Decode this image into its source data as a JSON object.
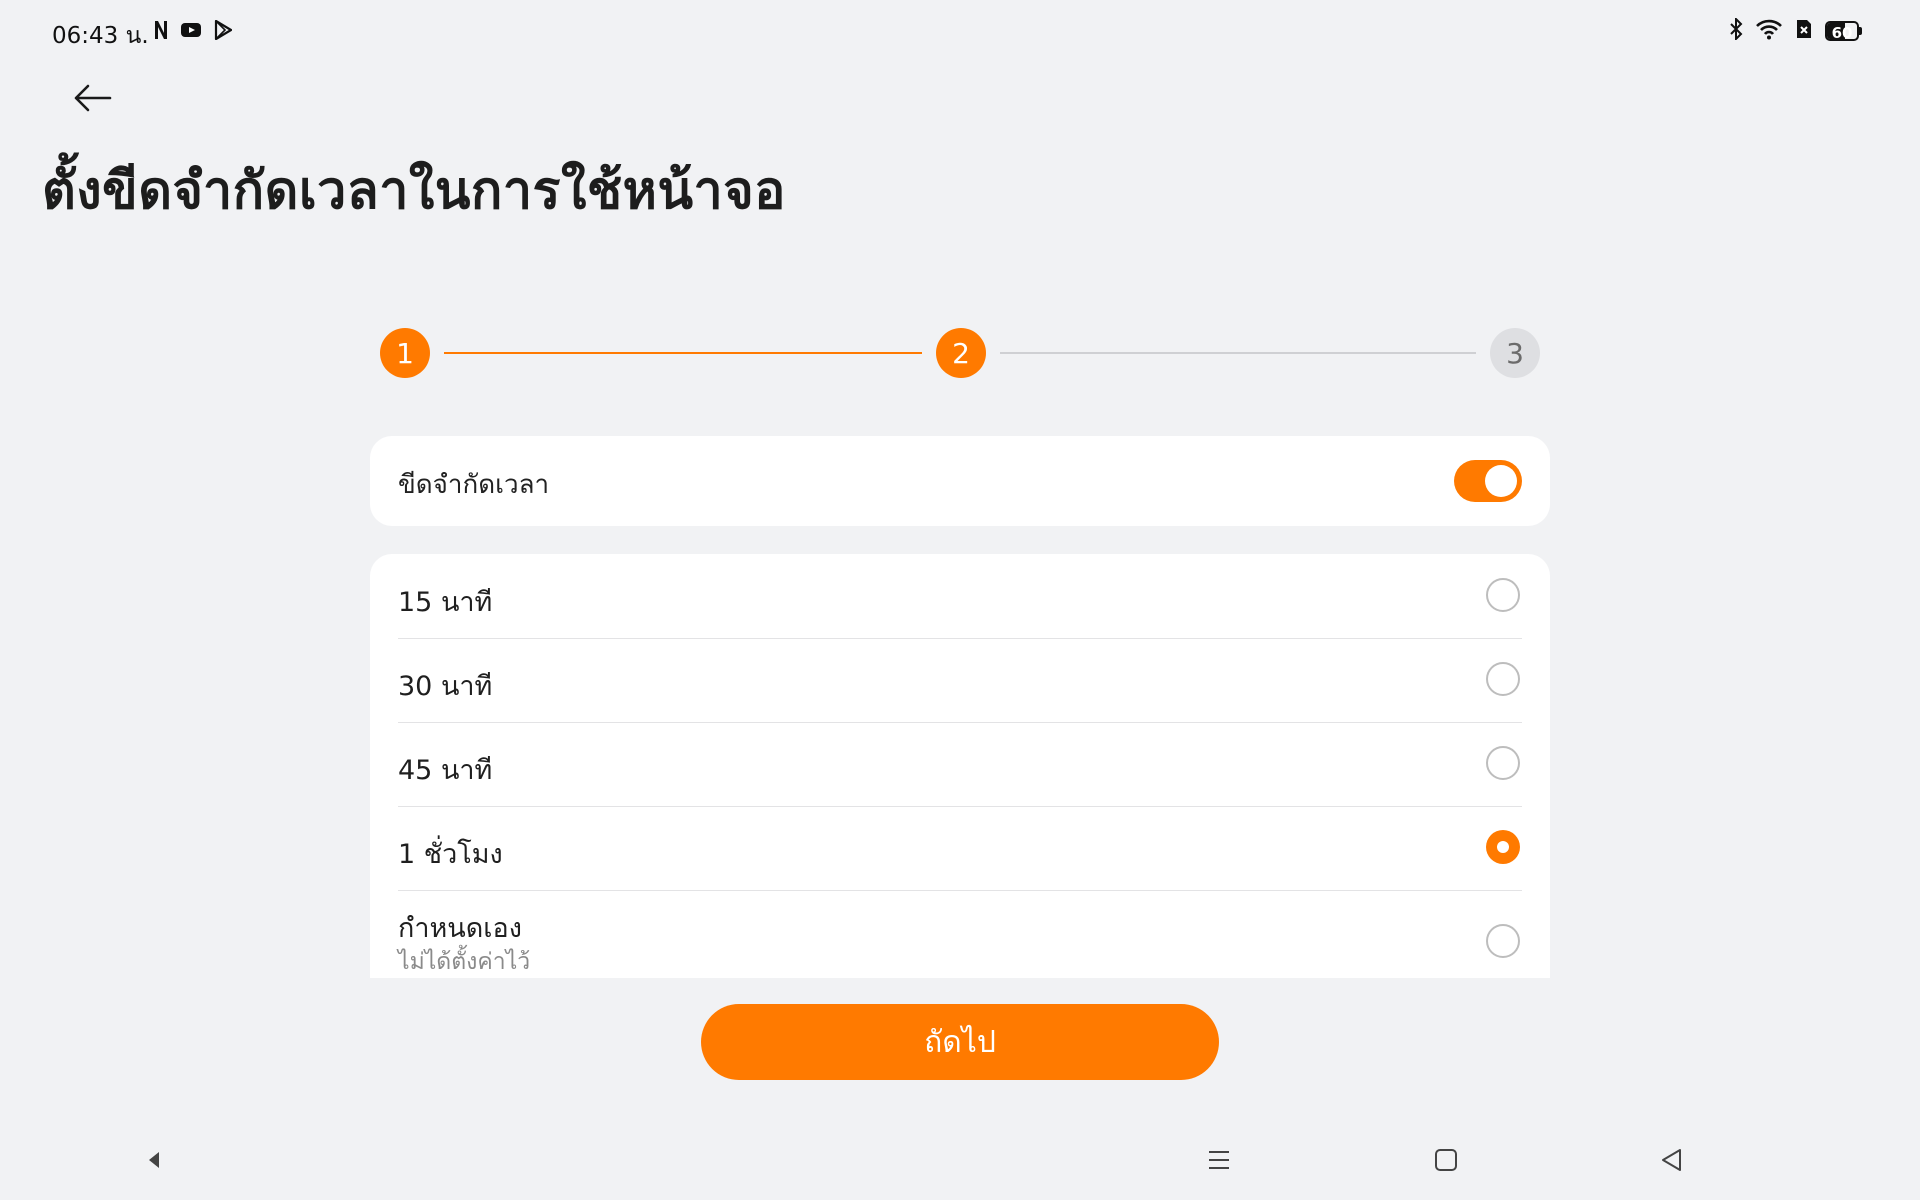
{
  "status_bar": {
    "time": "06:43 น.",
    "left_icons": [
      "netflix-icon",
      "youtube-icon",
      "play-store-icon"
    ],
    "right_icons": [
      "bluetooth-icon",
      "wifi-icon",
      "no-sim-icon"
    ],
    "battery": 60,
    "battery_label": "60"
  },
  "header": {
    "back_icon": "arrow-left-icon",
    "title": "ตั้งขีดจำกัดเวลาในการใช้หน้าจอ"
  },
  "stepper": {
    "steps": [
      {
        "label": "1",
        "state": "done"
      },
      {
        "label": "2",
        "state": "current"
      },
      {
        "label": "3",
        "state": "upcoming"
      }
    ]
  },
  "toggle_card": {
    "label": "ขีดจำกัดเวลา",
    "enabled": true
  },
  "options": [
    {
      "label": "15 นาที",
      "selected": false
    },
    {
      "label": "30 นาที",
      "selected": false
    },
    {
      "label": "45 นาที",
      "selected": false
    },
    {
      "label": "1 ชั่วโมง",
      "selected": true
    },
    {
      "label": "กำหนดเอง",
      "sublabel": "ไม่ได้ตั้งค่าไว้",
      "selected": false
    }
  ],
  "next_button": {
    "label": "ถัดไป"
  },
  "nav_bar": {
    "icons": [
      "hide-nav-icon",
      "menu-icon",
      "home-icon",
      "back-icon"
    ]
  },
  "colors": {
    "accent": "#ff7a00",
    "background": "#f1f2f4"
  }
}
